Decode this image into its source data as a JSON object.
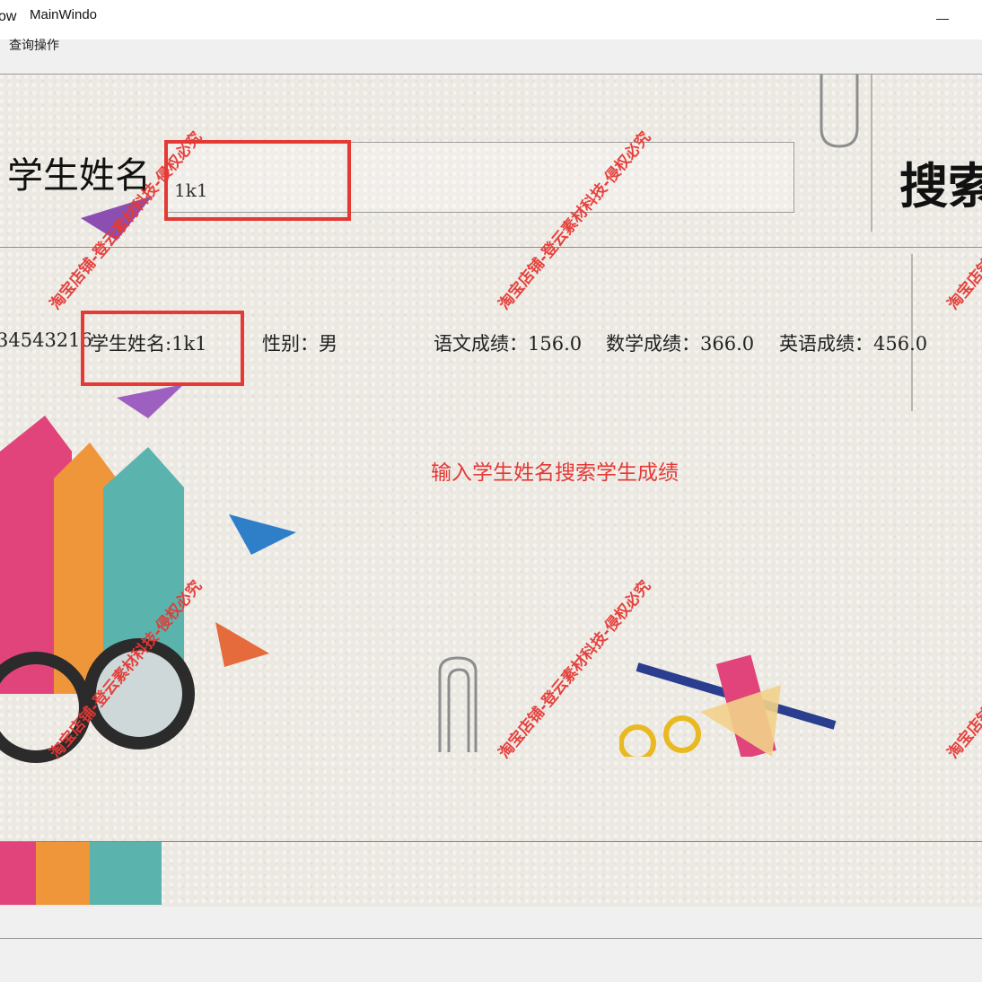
{
  "window": {
    "title_partial": "ow",
    "title": "MainWindo",
    "menu_text": "查询操作"
  },
  "search": {
    "label": "学生姓名",
    "value": "1k1",
    "button_label": "搜索"
  },
  "result": {
    "phone_partial": "34543216",
    "name": "学生姓名:1k1",
    "gender": "性别：男",
    "chinese": "语文成绩：156.0",
    "math": "数学成绩：366.0",
    "english": "英语成绩：456.0"
  },
  "hint_text": "输入学生姓名搜索学生成绩",
  "watermarks": {
    "text": "淘宝店铺-登云素材科技-侵权必究",
    "text_partial": "淘宝店铺"
  },
  "colors": {
    "accent_red": "#e53935",
    "paper_bg": "#ece9e3"
  }
}
